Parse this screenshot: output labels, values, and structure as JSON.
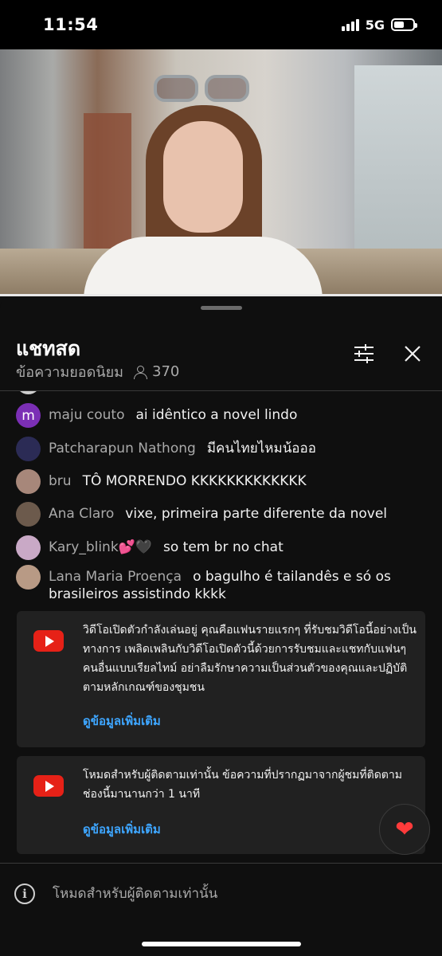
{
  "status_bar": {
    "time": "11:54",
    "network": "5G",
    "battery_level": 0.55
  },
  "chat_header": {
    "title": "แชทสด",
    "mode": "ข้อความยอดนิยม",
    "viewer_count": "370",
    "viewer_icon": "person-icon",
    "settings_icon": "tune-icon",
    "close_icon": "close-icon"
  },
  "messages": [
    {
      "author": "maju couto",
      "text": "ai idêntico a novel lindo",
      "avatar_letter": "m",
      "avatar_color": "#7b2fb5"
    },
    {
      "author": "Patcharapun Nathong",
      "text": "มีคนไทยไหมน้อออ",
      "avatar_letter": "",
      "avatar_color": "#2b2b55"
    },
    {
      "author": "bru",
      "text": "TÔ MORRENDO KKKKKKKKKKKKK",
      "avatar_letter": "",
      "avatar_color": "#a7877a"
    },
    {
      "author": "Ana Claro",
      "text": "vixe, primeira parte diferente da novel",
      "avatar_letter": "",
      "avatar_color": "#6c5a4c"
    },
    {
      "author": "Kary_blink💕🖤",
      "text": "so tem br no chat",
      "avatar_letter": "",
      "avatar_color": "#c9a9c6"
    },
    {
      "author": "Lana Maria Proença",
      "text": "o bagulho é tailandês e só os brasileiros assistindo kkkk",
      "avatar_letter": "",
      "avatar_color": "#b89a85"
    }
  ],
  "notices": [
    {
      "icon": "youtube-icon",
      "text": "วิดีโอเปิดตัวกำลังเล่นอยู่ คุณคือแฟนรายแรกๆ ที่รับชมวิดีโอนี้อย่างเป็นทางการ เพลิดเพลินกับวิดีโอเปิดตัวนี้ด้วยการรับชมและแชทกับแฟนๆ คนอื่นแบบเรียลไทม์ อย่าลืมรักษาความเป็นส่วนตัวของคุณและปฏิบัติตามหลักเกณฑ์ของชุมชน",
      "link": "ดูข้อมูลเพิ่มเติม"
    },
    {
      "icon": "youtube-icon",
      "text": "โหมดสำหรับผู้ติดตามเท่านั้น ข้อความที่ปรากฏมาจากผู้ชมที่ติดตามช่องนี้มานานกว่า 1 นาที",
      "link": "ดูข้อมูลเพิ่มเติม"
    }
  ],
  "reaction": {
    "icon": "heart-icon",
    "glyph": "❤"
  },
  "footer": {
    "info_icon": "info-icon",
    "info_glyph": "i",
    "text": "โหมดสำหรับผู้ติดตามเท่านั้น"
  }
}
